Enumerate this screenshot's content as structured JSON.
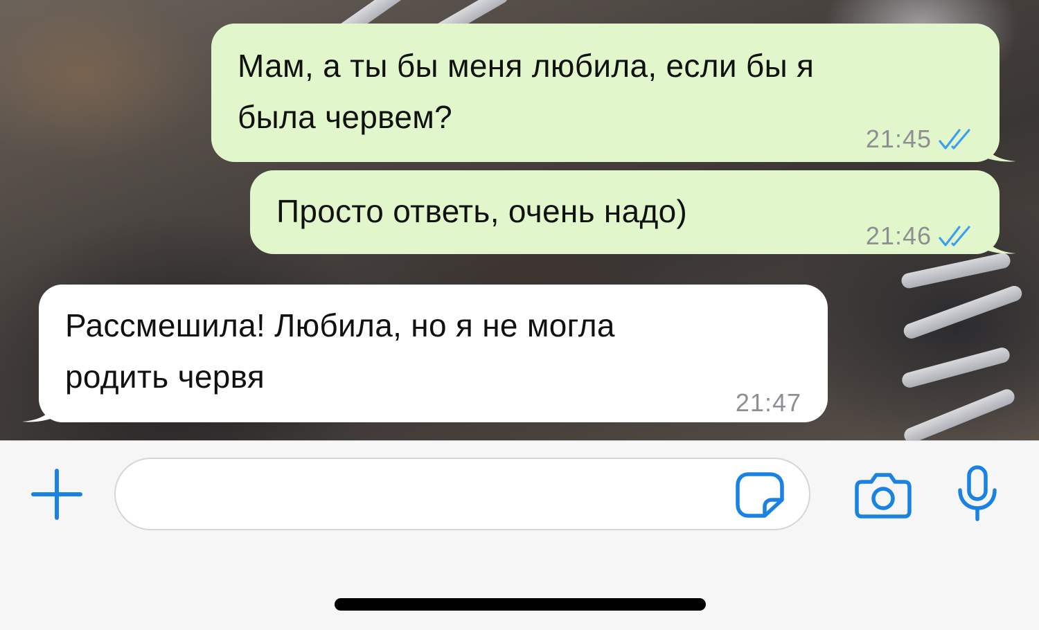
{
  "messages": [
    {
      "direction": "outgoing",
      "lines": [
        "Мам, а ты бы меня любила, если бы я",
        "была червем?"
      ],
      "time": "21:45",
      "status": "read"
    },
    {
      "direction": "outgoing",
      "lines": [
        "Просто ответь, очень надо)"
      ],
      "time": "21:46",
      "status": "read"
    },
    {
      "direction": "incoming",
      "lines": [
        "Рассмешила! Любила, но я не могла",
        "родить червя"
      ],
      "time": "21:47"
    }
  ],
  "composer": {
    "value": "",
    "placeholder": "",
    "icons": {
      "attach": "plus-icon",
      "sticker": "sticker-icon",
      "camera": "camera-icon",
      "mic": "microphone-icon"
    }
  },
  "colors": {
    "outgoing_bubble": "#e1f7cb",
    "incoming_bubble": "#ffffff",
    "accent": "#1a82e2",
    "read_ticks": "#3d9ef0",
    "timestamp": "#8e8e93"
  }
}
